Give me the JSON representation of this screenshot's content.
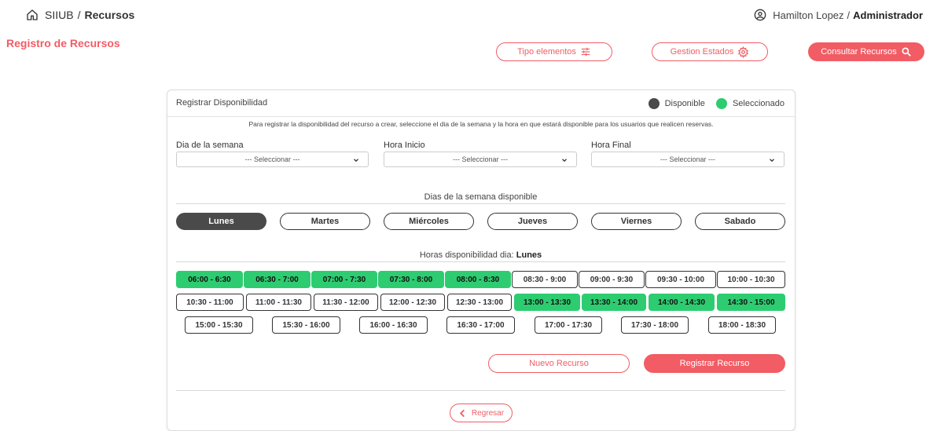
{
  "breadcrumb": {
    "root": "SIIUB",
    "separator": "/",
    "current": "Recursos"
  },
  "user": {
    "name": "Hamilton Lopez",
    "separator": "/",
    "role": "Administrador"
  },
  "page_title": "Registro de Recursos",
  "toolbar": {
    "tipo_elementos": "Tipo elementos",
    "gestion_estados": "Gestion Estados",
    "consultar_recursos": "Consultar Recursos"
  },
  "card": {
    "title": "Registrar Disponibilidad",
    "legend_available": "Disponible",
    "legend_selected": "Seleccionado",
    "instructions": "Para registrar la disponibilidad del recurso a crear, seleccione el dia de la semana y la hora en que estará disponible para los usuarios que realicen reservas."
  },
  "fields": {
    "day": {
      "label": "Dia de la semana",
      "value": "--- Seleccionar ---"
    },
    "start": {
      "label": "Hora Inicio",
      "value": "--- Seleccionar ---"
    },
    "end": {
      "label": "Hora Final",
      "value": "--- Seleccionar ---"
    }
  },
  "days_section": {
    "title": "Dias de la semana disponible",
    "days": [
      "Lunes",
      "Martes",
      "Miércoles",
      "Jueves",
      "Viernes",
      "Sabado"
    ],
    "active": "Lunes"
  },
  "hours_section": {
    "title_prefix": "Horas disponibilidad dia:",
    "title_day": "Lunes",
    "slots": [
      "06:00 - 6:30",
      "06:30 - 7:00",
      "07:00 - 7:30",
      "07:30 - 8:00",
      "08:00 - 8:30",
      "08:30 - 9:00",
      "09:00 - 9:30",
      "09:30 - 10:00",
      "10:00 - 10:30",
      "10:30 - 11:00",
      "11:00 - 11:30",
      "11:30 - 12:00",
      "12:00 - 12:30",
      "12:30 - 13:00",
      "13:00 - 13:30",
      "13:30 - 14:00",
      "14:00 - 14:30",
      "14:30 - 15:00",
      "15:00 - 15:30",
      "15:30 - 16:00",
      "16:00 - 16:30",
      "16:30 - 17:00",
      "17:00 - 17:30",
      "17:30 - 18:00",
      "18:00 - 18:30"
    ],
    "selected": [
      "06:00 - 6:30",
      "06:30 - 7:00",
      "07:00 - 7:30",
      "07:30 - 8:00",
      "08:00 - 8:30",
      "13:00 - 13:30",
      "13:30 - 14:00",
      "14:00 - 14:30",
      "14:30 - 15:00"
    ]
  },
  "actions": {
    "nuevo": "Nuevo Recurso",
    "registrar": "Registrar Recurso",
    "regresar": "Regresar"
  },
  "colors": {
    "accent": "#f25c64",
    "selected": "#2ecc71",
    "available": "#4a4a4a"
  }
}
